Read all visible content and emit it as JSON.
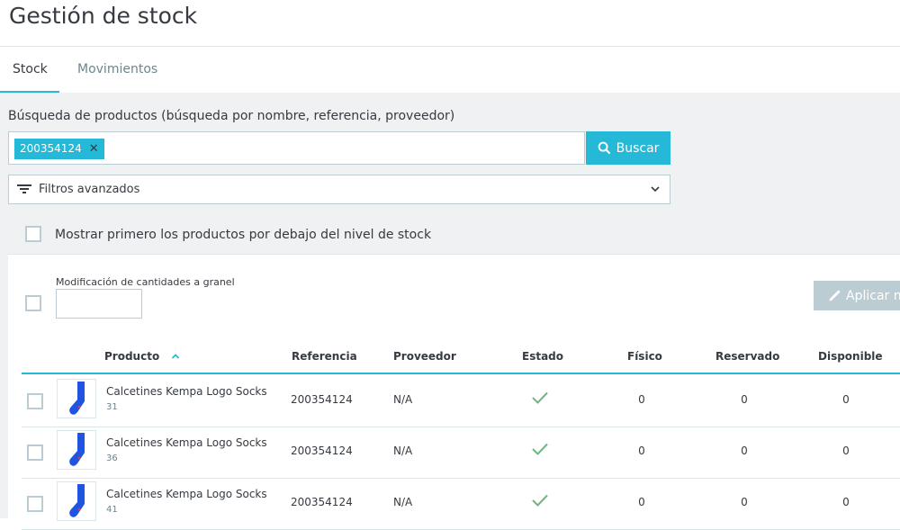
{
  "page": {
    "title": "Gestión de stock"
  },
  "tabs": [
    {
      "label": "Stock",
      "active": true
    },
    {
      "label": "Movimientos",
      "active": false
    }
  ],
  "search": {
    "label": "Búsqueda de productos (búsqueda por nombre, referencia, proveedor)",
    "tag": "200354124",
    "placeholder": "",
    "button_label": "Buscar"
  },
  "filters": {
    "label": "Filtros avanzados"
  },
  "low_stock": {
    "label": "Mostrar primero los productos por debajo del nivel de stock"
  },
  "bulk": {
    "label": "Modificación de cantidades a granel",
    "apply_label": "Aplicar n"
  },
  "table": {
    "headers": {
      "product": "Producto",
      "reference": "Referencia",
      "supplier": "Proveedor",
      "status": "Estado",
      "physical": "Físico",
      "reserved": "Reservado",
      "available": "Disponible"
    },
    "rows": [
      {
        "name": "Calcetines Kempa Logo Socks",
        "combination": "31",
        "reference": "200354124",
        "supplier": "N/A",
        "physical": "0",
        "reserved": "0",
        "available": "0"
      },
      {
        "name": "Calcetines Kempa Logo Socks",
        "combination": "36",
        "reference": "200354124",
        "supplier": "N/A",
        "physical": "0",
        "reserved": "0",
        "available": "0"
      },
      {
        "name": "Calcetines Kempa Logo Socks",
        "combination": "41",
        "reference": "200354124",
        "supplier": "N/A",
        "physical": "0",
        "reserved": "0",
        "available": "0"
      }
    ]
  },
  "colors": {
    "accent": "#25b9d7",
    "status_ok": "#70b580",
    "disabled_button": "#bbcdd2",
    "background": "#eff1f2"
  },
  "icons": {
    "sort": "chevron-up-icon",
    "status": "checkmark-icon",
    "search": "search-icon",
    "filter": "filter-icon",
    "edit": "pencil-icon"
  }
}
